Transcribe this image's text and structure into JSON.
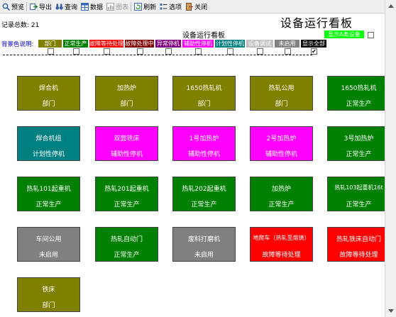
{
  "toolbar": {
    "preview": "预览",
    "export": "导出",
    "query": "查询",
    "data": "数据",
    "chart": "图表",
    "refresh": "刷新",
    "options": "选项",
    "close": "关闭"
  },
  "header": {
    "title": "设备运行看板",
    "subtitle": "设备运行看板",
    "record_count": "记录总数: 21",
    "show_a_button": "显示A类设备"
  },
  "legend": {
    "label": "背景色说明:",
    "items": [
      {
        "text": "部门",
        "color": "#808000",
        "checked": false
      },
      {
        "text": "正常生产",
        "color": "#008000",
        "checked": false
      },
      {
        "text": "故障等待处理",
        "color": "#ff0000",
        "checked": false
      },
      {
        "text": "故障处理中",
        "color": "#800000",
        "checked": false
      },
      {
        "text": "异常停机",
        "color": "#800080",
        "checked": false
      },
      {
        "text": "辅助性停机",
        "color": "#ff00ff",
        "checked": false
      },
      {
        "text": "计划性停机",
        "color": "#008080",
        "checked": false
      },
      {
        "text": "设备调试",
        "color": "#c0c0c0",
        "checked": false
      },
      {
        "text": "未启用",
        "color": "#808080",
        "checked": false
      },
      {
        "text": "显示全部",
        "color": "#000000",
        "checked": true
      }
    ]
  },
  "equipment": [
    {
      "name": "焊合机",
      "status": "部门",
      "color": "#808000"
    },
    {
      "name": "加热炉",
      "status": "部门",
      "color": "#808000"
    },
    {
      "name": "1650热轧机",
      "status": "部门",
      "color": "#808000"
    },
    {
      "name": "热轧公用",
      "status": "部门",
      "color": "#808000"
    },
    {
      "name": "1650热轧机",
      "status": "正常生产",
      "color": "#008000"
    },
    {
      "name": "焊合机组",
      "status": "计划性停机",
      "color": "#008080"
    },
    {
      "name": "双面铣床",
      "status": "辅助性停机",
      "color": "#ff00ff"
    },
    {
      "name": "1号加热炉",
      "status": "辅助性停机",
      "color": "#ff00ff"
    },
    {
      "name": "2号加热炉",
      "status": "辅助性停机",
      "color": "#ff00ff"
    },
    {
      "name": "3号加热炉",
      "status": "正常生产",
      "color": "#008000"
    },
    {
      "name": "热轧101起重机",
      "status": "正常生产",
      "color": "#008000"
    },
    {
      "name": "热轧201起重机",
      "status": "正常生产",
      "color": "#008000"
    },
    {
      "name": "热轧202起重机",
      "status": "正常生产",
      "color": "#008000"
    },
    {
      "name": "加热炉",
      "status": "正常生产",
      "color": "#008000"
    },
    {
      "name": "热轧103起重机16t",
      "status": "正常生产",
      "color": "#008000"
    },
    {
      "name": "车间公用",
      "status": "未启用",
      "color": "#808080"
    },
    {
      "name": "热轧自动门",
      "status": "正常生产",
      "color": "#008000"
    },
    {
      "name": "废料打磨机",
      "status": "未启用",
      "color": "#808080"
    },
    {
      "name": "地爬车（热轧至熔铸）",
      "status": "故障等待处理",
      "color": "#ff0000"
    },
    {
      "name": "热轧铁床自动门",
      "status": "故障等待处理",
      "color": "#ff0000"
    },
    {
      "name": "铁床",
      "status": "部门",
      "color": "#808000"
    }
  ]
}
